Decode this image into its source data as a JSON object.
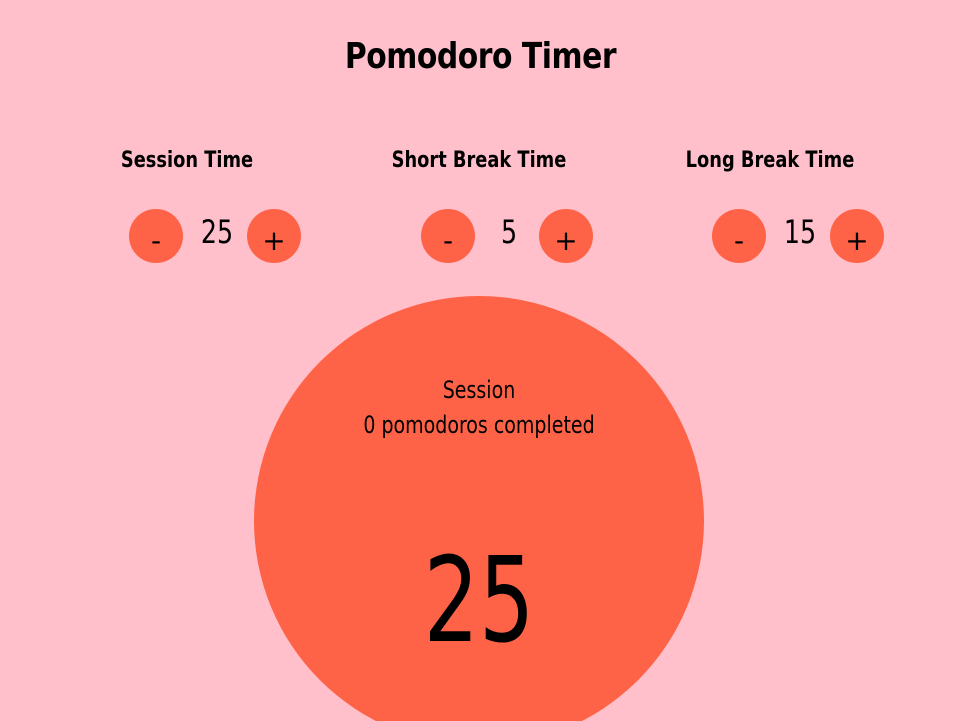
{
  "app": {
    "title": "Pomodoro Timer"
  },
  "controls": [
    {
      "label": "Session Time",
      "value": "25",
      "decrement": "-",
      "increment": "+"
    },
    {
      "label": "Short Break Time",
      "value": "5",
      "decrement": "-",
      "increment": "+"
    },
    {
      "label": "Long Break Time",
      "value": "15",
      "decrement": "-",
      "increment": "+"
    }
  ],
  "timer": {
    "mode": "Session",
    "completed": "0 pomodoros completed",
    "display": "25"
  },
  "colors": {
    "background": "#ffc0cb",
    "accent": "#ff6347",
    "text": "#000000"
  }
}
